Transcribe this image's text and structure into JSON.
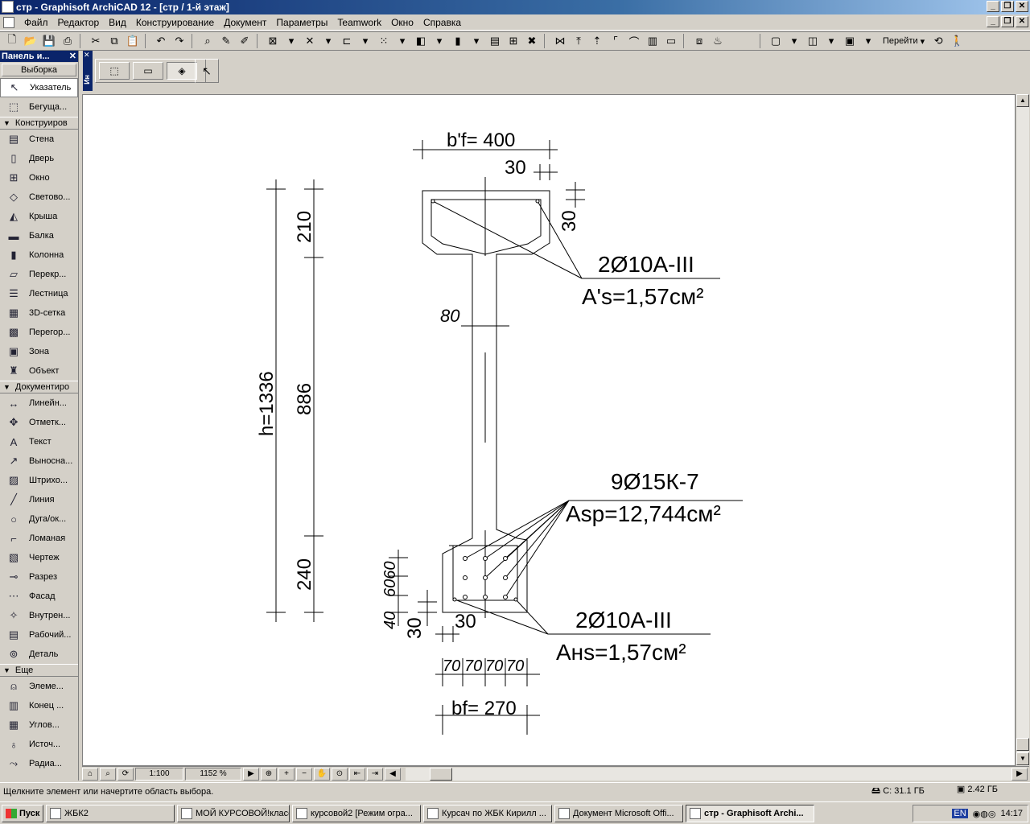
{
  "window": {
    "title": "стр - Graphisoft ArchiCAD 12 - [стр / 1-й этаж]"
  },
  "menu": [
    "Файл",
    "Редактор",
    "Вид",
    "Конструирование",
    "Документ",
    "Параметры",
    "Teamwork",
    "Окно",
    "Справка"
  ],
  "toolbar": {
    "goto_label": "Перейти"
  },
  "panel": {
    "title": "Панель и...",
    "selection_label": "Выборка",
    "top_tools": [
      {
        "label": "Указатель",
        "icon": "pointer-icon",
        "glyph": "↖"
      },
      {
        "label": "Бегуща...",
        "icon": "marquee-icon",
        "glyph": "⬚"
      }
    ],
    "section_design": "Конструиров",
    "design_tools": [
      {
        "label": "Стена",
        "icon": "wall-icon",
        "glyph": "▤"
      },
      {
        "label": "Дверь",
        "icon": "door-icon",
        "glyph": "▯"
      },
      {
        "label": "Окно",
        "icon": "window-icon",
        "glyph": "⊞"
      },
      {
        "label": "Светово...",
        "icon": "skylight-icon",
        "glyph": "◇"
      },
      {
        "label": "Крыша",
        "icon": "roof-icon",
        "glyph": "◭"
      },
      {
        "label": "Балка",
        "icon": "beam-icon",
        "glyph": "▬"
      },
      {
        "label": "Колонна",
        "icon": "column-icon",
        "glyph": "▮"
      },
      {
        "label": "Перекр...",
        "icon": "slab-icon",
        "glyph": "▱"
      },
      {
        "label": "Лестница",
        "icon": "stair-icon",
        "glyph": "☰"
      },
      {
        "label": "3D-сетка",
        "icon": "mesh-icon",
        "glyph": "▦"
      },
      {
        "label": "Перегор...",
        "icon": "curtainwall-icon",
        "glyph": "▩"
      },
      {
        "label": "Зона",
        "icon": "zone-icon",
        "glyph": "▣"
      },
      {
        "label": "Объект",
        "icon": "object-icon",
        "glyph": "♜"
      }
    ],
    "section_document": "Документиро",
    "document_tools": [
      {
        "label": "Линейн...",
        "icon": "linear-dimension-icon",
        "glyph": "↔"
      },
      {
        "label": "Отметк...",
        "icon": "level-dimension-icon",
        "glyph": "✥"
      },
      {
        "label": "Текст",
        "icon": "text-icon",
        "glyph": "A"
      },
      {
        "label": "Выносна...",
        "icon": "label-icon",
        "glyph": "↗"
      },
      {
        "label": "Штрихо...",
        "icon": "fill-icon",
        "glyph": "▨"
      },
      {
        "label": "Линия",
        "icon": "line-icon",
        "glyph": "╱"
      },
      {
        "label": "Дуга/ок...",
        "icon": "arc-icon",
        "glyph": "○"
      },
      {
        "label": "Ломаная",
        "icon": "polyline-icon",
        "glyph": "⌐"
      },
      {
        "label": "Чертеж",
        "icon": "drawing-icon",
        "glyph": "▧"
      },
      {
        "label": "Разрез",
        "icon": "section-icon",
        "glyph": "⊸"
      },
      {
        "label": "Фасад",
        "icon": "elevation-icon",
        "glyph": "⋯"
      },
      {
        "label": "Внутрен...",
        "icon": "interior-elevation-icon",
        "glyph": "✧"
      },
      {
        "label": "Рабочий...",
        "icon": "worksheet-icon",
        "glyph": "▤"
      },
      {
        "label": "Деталь",
        "icon": "detail-icon",
        "glyph": "⊚"
      }
    ],
    "section_more": "Еще",
    "more_tools": [
      {
        "label": "Элеме...",
        "icon": "wall-end-icon",
        "glyph": "⍝"
      },
      {
        "label": "Конец ...",
        "icon": "corner-window-icon",
        "glyph": "▥"
      },
      {
        "label": "Углов...",
        "icon": "camera-icon",
        "glyph": "▦"
      },
      {
        "label": "Источ...",
        "icon": "lamp-icon",
        "glyph": "♁"
      },
      {
        "label": "Радиа...",
        "icon": "radial-dimension-icon",
        "glyph": "⤳"
      }
    ]
  },
  "infobox": {
    "tab_label": "Ин"
  },
  "drawing": {
    "dim_top_width": "b'f= 400",
    "dim_top_cover": "30",
    "dim_top_cover_side": "30",
    "dim_h_total": "h=1336",
    "dim_210": "210",
    "dim_886": "886",
    "dim_240": "240",
    "dim_80": "80",
    "dim_6060": "6060",
    "dim_40": "40",
    "dim_30_left": "30",
    "dim_30_bottom": "30",
    "dim_70_1": "70",
    "dim_70_2": "70",
    "dim_70_3": "70",
    "dim_70_4": "70",
    "dim_bottom_width": "bf= 270",
    "label_top_rebar": "2Ø10А-III",
    "label_top_area": "A's=1,57см²",
    "label_strand": "9Ø15К-7",
    "label_strand_area": "Asp=12,744см²",
    "label_bottom_rebar": "2Ø10А-III",
    "label_bottom_area": "Aнs=1,57см²"
  },
  "navbar": {
    "scale": "1:100",
    "zoom": "1152 %"
  },
  "status": {
    "hint": "Щелкните элемент или начертите область выбора.",
    "disk_c": "C: 31.1 ГБ",
    "memory": "2.42 ГБ"
  },
  "taskbar": {
    "start_label": "Пуск",
    "tasks": [
      {
        "label": "ЖБК2",
        "active": false
      },
      {
        "label": "МОЙ КУРСОВОЙ!класс ...",
        "active": false
      },
      {
        "label": "курсовой2 [Режим огра...",
        "active": false
      },
      {
        "label": "Курсач по ЖБК Кирилл ...",
        "active": false
      },
      {
        "label": "Документ Microsoft Offi...",
        "active": false
      },
      {
        "label": "стр - Graphisoft Archi...",
        "active": true
      }
    ],
    "lang": "EN",
    "clock": "14:17"
  }
}
